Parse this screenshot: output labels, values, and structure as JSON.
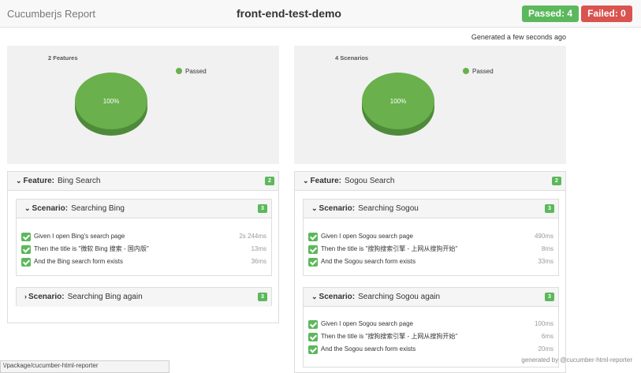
{
  "header": {
    "app_title": "Cucumberjs Report",
    "project_title": "front-end-test-demo",
    "passed_label": "Passed: 4",
    "failed_label": "Failed: 0",
    "passed_color": "#5cb85c",
    "failed_color": "#d9534f"
  },
  "generated_text": "Generated a few seconds ago",
  "charts": [
    {
      "title": "2 Features",
      "legend": "Passed",
      "percent_label": "100%",
      "passed_fraction": 1.0,
      "color": "#6ab04c"
    },
    {
      "title": "4 Scenarios",
      "legend": "Passed",
      "percent_label": "100%",
      "passed_fraction": 1.0,
      "color": "#6ab04c"
    }
  ],
  "features": [
    {
      "keyword": "Feature:",
      "name": "Bing Search",
      "count": "2",
      "scenarios": [
        {
          "keyword": "Scenario:",
          "name": "Searching Bing",
          "count": "3",
          "expanded": true,
          "steps": [
            {
              "text": "Given I open Bing's search page",
              "duration": "2s 244ms"
            },
            {
              "text": "Then the title is \"微软 Bing 搜索 - 国内版\"",
              "duration": "13ms"
            },
            {
              "text": "And the Bing search form exists",
              "duration": "36ms"
            }
          ]
        },
        {
          "keyword": "Scenario:",
          "name": "Searching Bing again",
          "count": "3",
          "expanded": false,
          "steps": []
        }
      ]
    },
    {
      "keyword": "Feature:",
      "name": "Sogou Search",
      "count": "2",
      "scenarios": [
        {
          "keyword": "Scenario:",
          "name": "Searching Sogou",
          "count": "3",
          "expanded": true,
          "steps": [
            {
              "text": "Given I open Sogou search page",
              "duration": "490ms"
            },
            {
              "text": "Then the title is \"搜狗搜索引擎 - 上网从搜狗开始\"",
              "duration": "8ms"
            },
            {
              "text": "And the Sogou search form exists",
              "duration": "33ms"
            }
          ]
        },
        {
          "keyword": "Scenario:",
          "name": "Searching Sogou again",
          "count": "3",
          "expanded": true,
          "steps": [
            {
              "text": "Given I open Sogou search page",
              "duration": "100ms"
            },
            {
              "text": "Then the title is \"搜狗搜索引擎 - 上网从搜狗开始\"",
              "duration": "6ms"
            },
            {
              "text": "And the Sogou search form exists",
              "duration": "20ms"
            }
          ]
        }
      ]
    }
  ],
  "status_url": "\\/package/cucumber-html-reporter",
  "footer_credit": "generated by @cucumber-html-reporter"
}
